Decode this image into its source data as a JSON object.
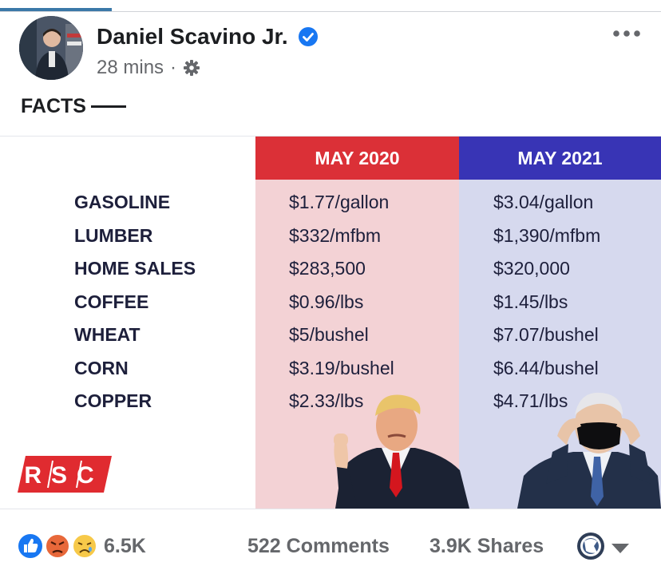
{
  "post": {
    "author": "Daniel Scavino Jr.",
    "time": "28 mins",
    "separator": "·",
    "text": "FACTS"
  },
  "graphic": {
    "header_2020": "MAY 2020",
    "header_2021": "MAY 2021",
    "rows": [
      {
        "label": "GASOLINE",
        "may2020": "$1.77/gallon",
        "may2021": "$3.04/gallon"
      },
      {
        "label": "LUMBER",
        "may2020": "$332/mfbm",
        "may2021": "$1,390/mfbm"
      },
      {
        "label": "HOME SALES",
        "may2020": "$283,500",
        "may2021": "$320,000"
      },
      {
        "label": "COFFEE",
        "may2020": "$0.96/lbs",
        "may2021": "$1.45/lbs"
      },
      {
        "label": "WHEAT",
        "may2020": "$5/bushel",
        "may2021": "$7.07/bushel"
      },
      {
        "label": "CORN",
        "may2020": "$3.19/bushel",
        "may2021": "$6.44/bushel"
      },
      {
        "label": "COPPER",
        "may2020": "$2.33/lbs",
        "may2021": "$4.71/lbs"
      }
    ],
    "logo_text": "RSC"
  },
  "footer": {
    "reaction_count": "6.5K",
    "comments": "522 Comments",
    "shares": "3.9K Shares"
  },
  "icons": {
    "verified": "verified-badge-icon",
    "audience": "gear-icon",
    "more": "more-options-icon",
    "like": "like-reaction-icon",
    "angry": "angry-reaction-icon",
    "sad": "sad-reaction-icon"
  },
  "colors": {
    "may2020_header": "#db3037",
    "may2020_column": "#f3d2d5",
    "may2021_header": "#3834b5",
    "may2021_column": "#d6d9ee",
    "verified": "#1877f2",
    "rsc_red": "#e02b30"
  }
}
